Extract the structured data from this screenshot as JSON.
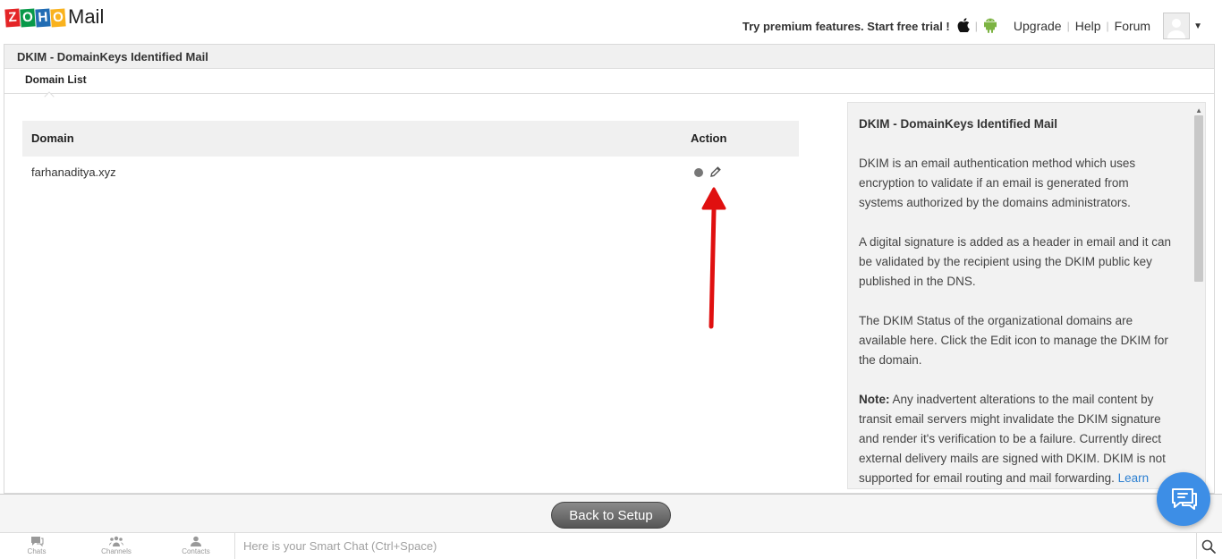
{
  "brand": {
    "logo_letters": [
      "Z",
      "O",
      "H",
      "O"
    ],
    "logo_colors": [
      "#e42527",
      "#089949",
      "#226db4",
      "#f9b21d"
    ],
    "app_name": "Mail"
  },
  "topnav": {
    "premium_text": "Try premium features. Start free trial !",
    "upgrade": "Upgrade",
    "help": "Help",
    "forum": "Forum"
  },
  "panel": {
    "title": "DKIM - DomainKeys Identified Mail",
    "tab": "Domain List"
  },
  "table": {
    "headers": {
      "domain": "Domain",
      "action": "Action"
    },
    "rows": [
      {
        "domain": "farhanaditya.xyz",
        "status_color": "#777777"
      }
    ]
  },
  "help": {
    "title": "DKIM - DomainKeys Identified Mail",
    "p1": "DKIM is an email authentication method which uses encryption to validate if an email is generated from systems authorized by the domains administrators.",
    "p2": "A digital signature is added as a header in email and it can be validated by the recipient using the DKIM public key published in the DNS.",
    "p3": "The DKIM Status of the organizational domains are available here. Click the Edit icon to manage the DKIM for the domain.",
    "note_label": "Note:",
    "note_text": " Any inadvertent alterations to the mail content by transit email servers might invalidate the DKIM signature and render it's verification to be a failure. Currently direct external delivery mails are signed with DKIM. DKIM is not supported for email routing and mail forwarding. ",
    "learn_more": "Learn more"
  },
  "actions": {
    "back_to_setup": "Back to Setup"
  },
  "footer": {
    "chats": "Chats",
    "channels": "Channels",
    "contacts": "Contacts",
    "smartchat_placeholder": "Here is your Smart Chat (Ctrl+Space)"
  },
  "colors": {
    "annotation_arrow": "#e01010",
    "chat_fab": "#3d8ee6",
    "link": "#2b7fd1"
  }
}
